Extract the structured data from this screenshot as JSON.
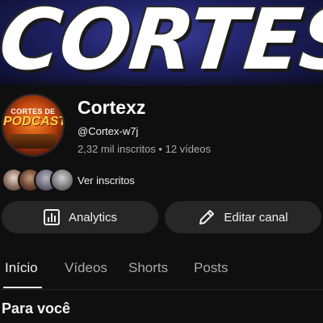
{
  "banner": {
    "text": "CORTES"
  },
  "channel": {
    "avatar_line1": "CORTES DE",
    "avatar_line2": "PODCAST",
    "name": "Cortexz",
    "handle": "@Cortex-w7j",
    "stats": "2,32 mil inscritos • 12 vídeos"
  },
  "subscribers": {
    "link_label": "Ver inscritos"
  },
  "buttons": {
    "analytics_label": "Analytics",
    "edit_label": "Editar canal"
  },
  "tabs": [
    {
      "label": "Início"
    },
    {
      "label": "Vídeos"
    },
    {
      "label": "Shorts"
    },
    {
      "label": "Posts"
    }
  ],
  "section": {
    "title": "Para você"
  }
}
